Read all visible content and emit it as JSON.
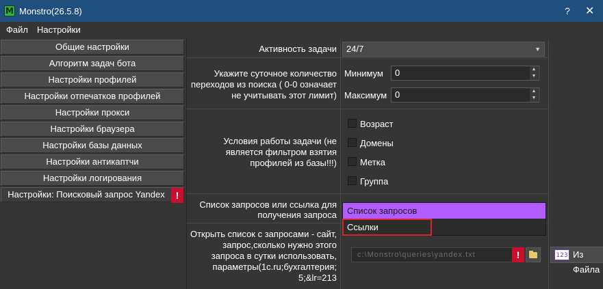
{
  "window": {
    "title": "Monstro(26.5.8)",
    "help": "?",
    "close": "✕",
    "icon_letter": "M"
  },
  "menu": {
    "file": "Файл",
    "settings": "Настройки"
  },
  "sidebar": {
    "items": [
      {
        "label": "Общие настройки"
      },
      {
        "label": "Алгоритм задач бота"
      },
      {
        "label": "Настройки профилей"
      },
      {
        "label": "Настройки отпечатков профилей"
      },
      {
        "label": "Настройки прокси"
      },
      {
        "label": "Настройки браузера"
      },
      {
        "label": "Настройки базы данных"
      },
      {
        "label": "Настройки антикаптчи"
      },
      {
        "label": "Настройки логирования"
      },
      {
        "label": "Настройки: Поисковый запрос Yandex"
      }
    ],
    "warn_mark": "!"
  },
  "form": {
    "activity_label": "Активность задачи",
    "activity_value": "24/7",
    "daily_label_1": "Укажите суточное количество",
    "daily_label_2": "переходов из поиска ( 0-0 означает",
    "daily_label_3": "не учитывать этот лимит)",
    "min_label": "Минимум",
    "min_value": "0",
    "max_label": "Максимум",
    "max_value": "0",
    "conditions_label_1": "Условия работы задачи (не",
    "conditions_label_2": "является фильтром взятия",
    "conditions_label_3": "профилей из базы!!!)",
    "conditions": [
      {
        "label": "Возраст",
        "checked": false
      },
      {
        "label": "Домены",
        "checked": false
      },
      {
        "label": "Метка",
        "checked": false
      },
      {
        "label": "Группа",
        "checked": false
      }
    ],
    "list_label_1": "Список запросов или ссылка для",
    "list_label_2": "получения запроса",
    "list_options": [
      "Список запросов",
      "Ссылки"
    ],
    "list_selected": "Список запросов",
    "open_label_1": "Открыть список с запросами - сайт,",
    "open_label_2": "запрос,сколько нужно этого",
    "open_label_3": "запроса в сутки использовать,",
    "open_label_4": "параметры(1c.ru;бухгалтерия;",
    "open_label_5": "5;&lr=213",
    "path_value": "c:\\Monstro\\queries\\yandex.txt",
    "path_warn": "!",
    "from_file_label": "Из Файла",
    "from_file_icon": "123"
  },
  "colors": {
    "accent_purple": "#b25cff",
    "warn_red": "#c8102e",
    "highlight_red": "#d6242d",
    "titlebar": "#1f4f7d"
  }
}
